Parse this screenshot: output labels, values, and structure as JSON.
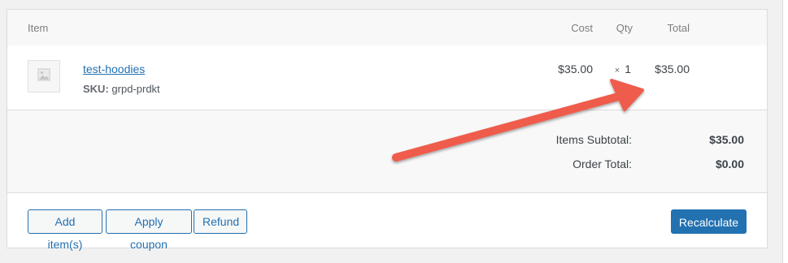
{
  "table": {
    "headers": {
      "item": "Item",
      "cost": "Cost",
      "qty": "Qty",
      "total": "Total"
    },
    "rows": [
      {
        "name": "test-hoodies",
        "sku_label": "SKU:",
        "sku": "grpd-prdkt",
        "cost": "$35.00",
        "qty_sign": "×",
        "qty": "1",
        "total": "$35.00",
        "thumbnail_icon": "image-placeholder-icon"
      }
    ]
  },
  "totals": {
    "items_subtotal_label": "Items Subtotal:",
    "items_subtotal_value": "$35.00",
    "order_total_label": "Order Total:",
    "order_total_value": "$0.00"
  },
  "actions": {
    "add_items": "Add item(s)",
    "apply_coupon": "Apply coupon",
    "refund": "Refund",
    "recalculate": "Recalculate"
  },
  "annotation": {
    "arrow_color": "#ef5b4c",
    "arrow_icon": "annotation-arrow-icon"
  },
  "colors": {
    "link": "#2271b1",
    "primary_button": "#2271b1",
    "header_background": "#f8f8f8"
  }
}
